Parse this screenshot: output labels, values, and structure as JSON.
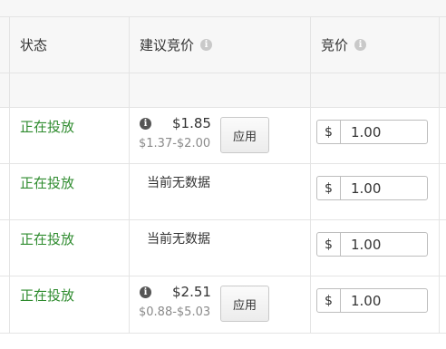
{
  "header": {
    "status_label": "状态",
    "suggested_bid_label": "建议竞价",
    "bid_label": "竞价",
    "info_glyph": "i"
  },
  "rows": [
    {
      "status": "正在投放",
      "suggested": {
        "price": "$1.85",
        "range": "$1.37-$2.00",
        "apply_label": "应用"
      },
      "currency": "$",
      "bid": "1.00"
    },
    {
      "status": "正在投放",
      "no_data": "当前无数据",
      "currency": "$",
      "bid": "1.00"
    },
    {
      "status": "正在投放",
      "no_data": "当前无数据",
      "currency": "$",
      "bid": "1.00"
    },
    {
      "status": "正在投放",
      "suggested": {
        "price": "$2.51",
        "range": "$0.88-$5.03",
        "apply_label": "应用"
      },
      "currency": "$",
      "bid": "1.00"
    }
  ],
  "colors": {
    "status_active": "#2e8b2e",
    "header_bg": "#f7f7f7",
    "border": "#e4e4e4"
  },
  "icons": {
    "header_info": "info-circle-icon",
    "row_info": "info-circle-icon"
  }
}
